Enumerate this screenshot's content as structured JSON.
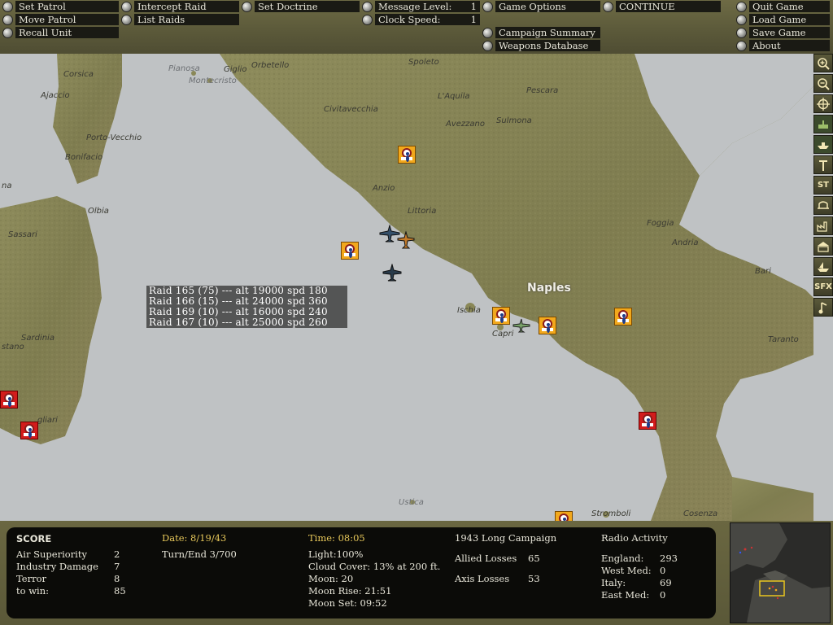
{
  "menu": {
    "set_patrol": "Set Patrol",
    "move_patrol": "Move Patrol",
    "recall_unit": "Recall Unit",
    "intercept_raid": "Intercept Raid",
    "list_raids": "List Raids",
    "set_doctrine": "Set Doctrine",
    "message_level_label": "Message Level:",
    "message_level_value": "1",
    "clock_speed_label": "Clock Speed:",
    "clock_speed_value": "1",
    "game_options": "Game Options",
    "campaign_summary": "Campaign Summary",
    "weapons_database": "Weapons Database",
    "continue": "CONTINUE",
    "quit_game": "Quit Game",
    "load_game": "Load Game",
    "save_game": "Save Game",
    "about": "About"
  },
  "map": {
    "labels": {
      "corsica": "Corsica",
      "ajaccio": "Ajaccio",
      "porto_vecchio": "Porto-Vecchio",
      "bonifacio": "Bonifacio",
      "pianosa": "Pianosa",
      "montecristo": "Montecristo",
      "giglio": "Giglio",
      "orbetello": "Orbetello",
      "spoleto": "Spoleto",
      "pescara": "Pescara",
      "l_aquila": "L'Aquila",
      "civitavecchia": "Civitavecchia",
      "avezzano": "Avezzano",
      "sulmona": "Sulmona",
      "anzio": "Anzio",
      "littoria": "Littoria",
      "foggia": "Foggia",
      "andria": "Andria",
      "bari": "Bari",
      "naples": "Naples",
      "ischia": "Ischia",
      "capri": "Capri",
      "taranto": "Taranto",
      "sassari": "Sassari",
      "olbia": "Olbia",
      "sardinia": "Sardinia",
      "oristano": "stano",
      "cagliari": "gliari",
      "ustica": "Ustica",
      "stromboli": "Stromboli",
      "cosenza": "Cosenza",
      "partial_na": "na"
    },
    "raids": [
      "Raid 165 (75) --- alt 19000 spd 180",
      "Raid 166 (15) --- alt 24000 spd 360",
      "Raid 169 (10) --- alt 16000 spd 240",
      "Raid 167 (10) --- alt 25000 spd 260"
    ],
    "tools": [
      "zoom-in",
      "zoom-out",
      "center",
      "flak",
      "ships",
      "rail",
      "ST",
      "bridge",
      "factory",
      "building",
      "boat",
      "SFX",
      "music"
    ],
    "tool_text": {
      "st": "ST",
      "sfx": "SFX"
    }
  },
  "status": {
    "score_title": "SCORE",
    "air_superiority_label": "Air Superiority",
    "air_superiority_value": "2",
    "industry_damage_label": "Industry Damage",
    "industry_damage_value": "7",
    "terror_label": "Terror",
    "terror_value": "8",
    "to_win_label": "to win:",
    "to_win_value": "85",
    "date": "Date: 8/19/43",
    "turn_end": "Turn/End  3/700",
    "time": "Time: 08:05",
    "light": "Light:100%",
    "cloud_cover": "Cloud Cover: 13% at 200 ft.",
    "moon": "Moon: 20",
    "moon_rise": "Moon Rise: 21:51",
    "moon_set": "Moon Set: 09:52",
    "campaign_name": "1943 Long Campaign",
    "allied_losses_label": "Allied Losses",
    "allied_losses_value": "65",
    "axis_losses_label": "Axis Losses",
    "axis_losses_value": "53",
    "radio_title": "Radio Activity",
    "england_label": "England:",
    "england_value": "293",
    "west_med_label": "West Med:",
    "west_med_value": "0",
    "italy_label": "Italy:",
    "italy_value": "69",
    "east_med_label": "East Med:",
    "east_med_value": "0"
  },
  "colors": {
    "sea": "#bfc2c4",
    "land": "#8a8a5a",
    "axis_unit": "#f2a81c",
    "allied_unit": "#d21c1c",
    "panel": "#0b0b08",
    "highlight_text": "#e7c85a"
  }
}
